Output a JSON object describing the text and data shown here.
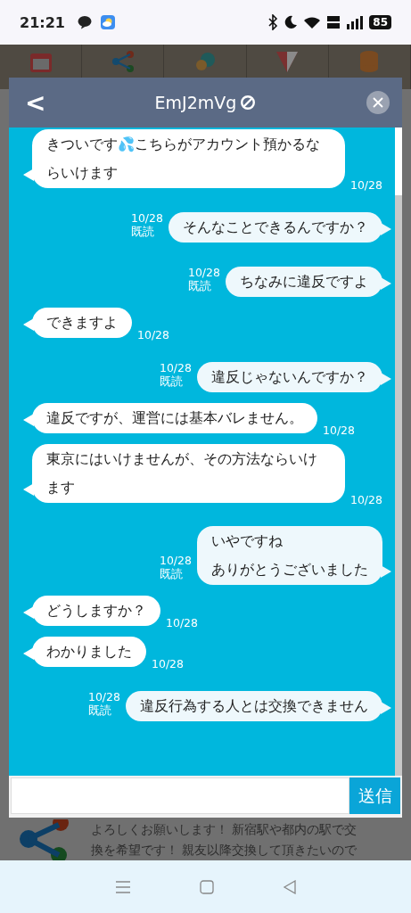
{
  "status_bar": {
    "time": "21:21",
    "battery": "85"
  },
  "background_post": {
    "lines": [
      "よろしくお願いします！ 新宿駅や都内の駅で交",
      "換を希望です！ 親友以降交換して頂きたいので"
    ]
  },
  "chat": {
    "back": "<",
    "title": "EmJ2mVg",
    "messages": [
      {
        "kind": "received",
        "lines": [
          "きついです💦こちらがアカウント預かるならいけます"
        ],
        "date": "10/28"
      },
      {
        "kind": "sent",
        "lines": [
          "そんなことできるんですか？"
        ],
        "date": "10/28",
        "read": "既読"
      },
      {
        "kind": "sent",
        "lines": [
          "ちなみに違反ですよ"
        ],
        "date": "10/28",
        "read": "既読"
      },
      {
        "kind": "received",
        "lines": [
          "できますよ"
        ],
        "date": "10/28"
      },
      {
        "kind": "sent",
        "lines": [
          "違反じゃないんですか？"
        ],
        "date": "10/28",
        "read": "既読"
      },
      {
        "kind": "received",
        "lines": [
          "違反ですが、運営には基本バレません。"
        ],
        "date": "10/28"
      },
      {
        "kind": "received",
        "lines": [
          "東京にはいけませんが、その方法ならいけます"
        ],
        "date": "10/28"
      },
      {
        "kind": "sent",
        "lines": [
          "いやですね",
          "ありがとうございました"
        ],
        "date": "10/28",
        "read": "既読"
      },
      {
        "kind": "received",
        "lines": [
          "どうしますか？"
        ],
        "date": "10/28"
      },
      {
        "kind": "received",
        "lines": [
          "わかりました"
        ],
        "date": "10/28"
      },
      {
        "kind": "sent",
        "lines": [
          "違反行為する人とは交換できません"
        ],
        "date": "10/28",
        "read": "既読"
      }
    ],
    "send_button": "送信"
  }
}
